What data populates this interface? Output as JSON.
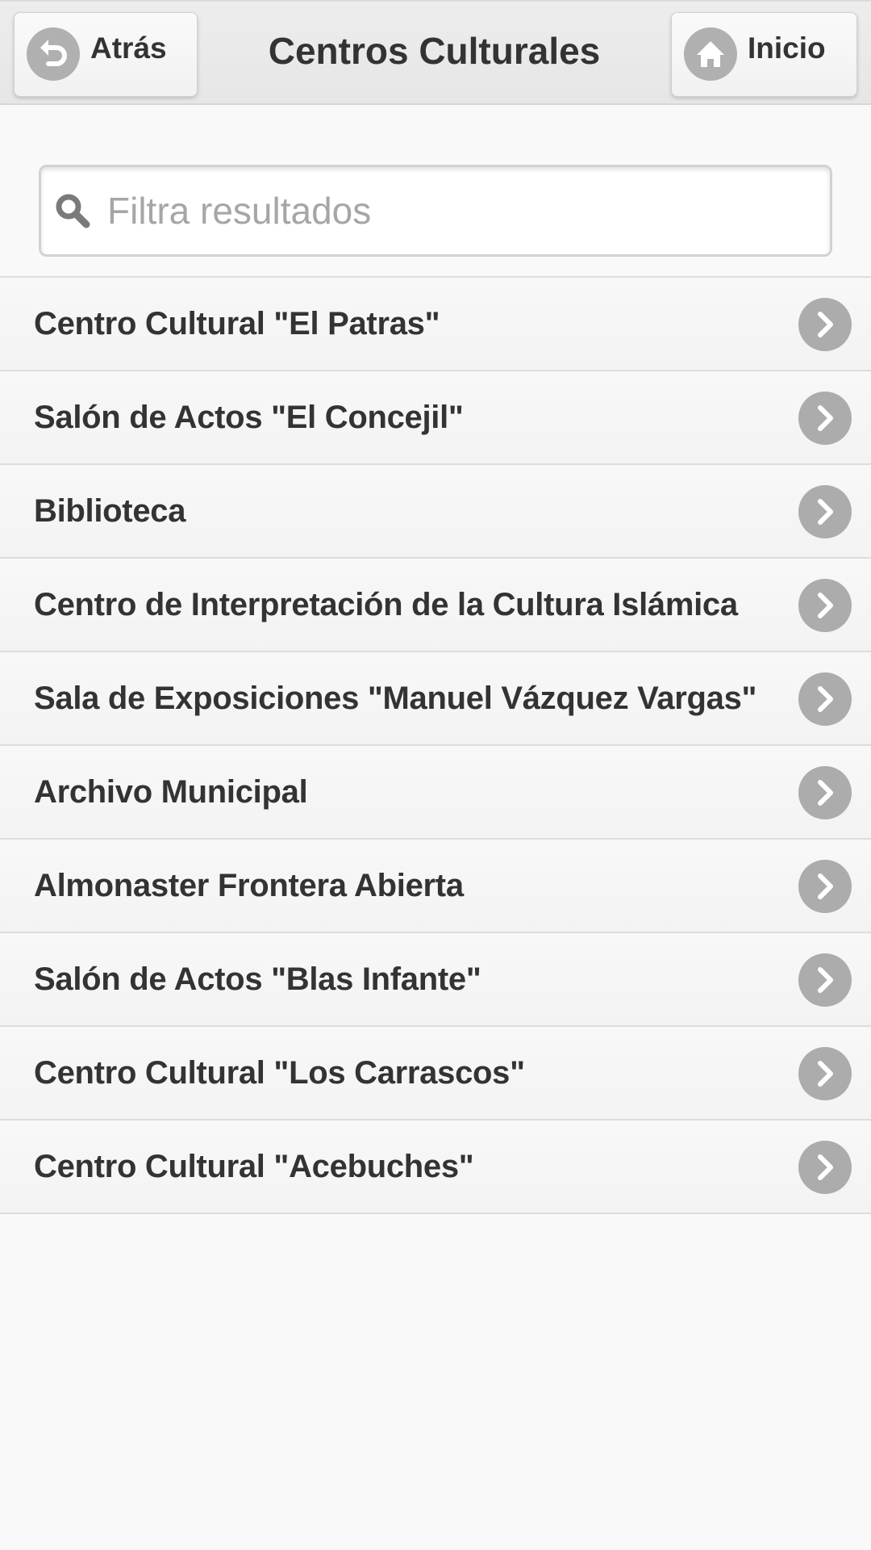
{
  "header": {
    "title": "Centros Culturales",
    "back_label": "Atrás",
    "back_icon": "back-arrow-icon",
    "home_label": "Inicio",
    "home_icon": "home-icon"
  },
  "search": {
    "placeholder": "Filtra resultados",
    "value": "",
    "icon": "search-icon"
  },
  "list": {
    "item_icon": "chevron-right-icon",
    "items": [
      {
        "label": "Centro Cultural \"El Patras\""
      },
      {
        "label": "Salón de Actos \"El Concejil\""
      },
      {
        "label": "Biblioteca"
      },
      {
        "label": "Centro de Interpretación de la Cultura Islámica"
      },
      {
        "label": "Sala de Exposiciones \"Manuel Vázquez Vargas\""
      },
      {
        "label": "Archivo Municipal"
      },
      {
        "label": "Almonaster Frontera Abierta"
      },
      {
        "label": "Salón de Actos \"Blas Infante\""
      },
      {
        "label": "Centro Cultural \"Los Carrascos\""
      },
      {
        "label": "Centro Cultural \"Acebuches\""
      }
    ]
  },
  "colors": {
    "background": "#f9f9f9",
    "text": "#333333",
    "icon_disc": "#acacac",
    "divider": "#dddddd"
  }
}
